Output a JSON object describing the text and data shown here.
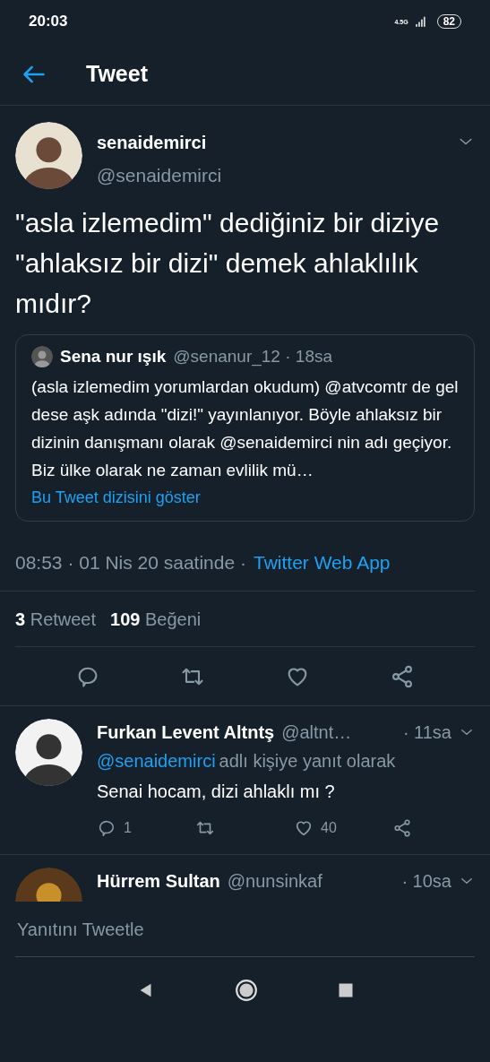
{
  "status_bar": {
    "time": "20:03",
    "network": "4.5G",
    "battery": "82"
  },
  "header": {
    "title": "Tweet"
  },
  "tweet": {
    "name": "senaidemirci",
    "handle": "@senaidemirci",
    "text": "\"asla izlemedim\" dediğiniz bir diziye \"ahlaksız bir dizi\" demek ahlaklılık mıdır?",
    "quote": {
      "name": "Sena nur ışık",
      "handle": "@senanur_12 · 18sa",
      "text": "(asla izlemedim yorumlardan okudum) @atvcomtr de gel dese aşk adında \"dizi!\" yayınlanıyor. Böyle ahlaksız bir dizinin danışmanı olarak @senaidemirci nin adı geçiyor. Biz ülke olarak ne zaman evlilik mü…",
      "link": "Bu Tweet dizisini göster"
    },
    "meta": {
      "time": "08:53 · 01 Nis 20 saatinde · ",
      "source": "Twitter Web App"
    },
    "stats": [
      {
        "count": "3",
        "label": "Retweet"
      },
      {
        "count": "109",
        "label": "Beğeni"
      }
    ]
  },
  "replies": [
    {
      "name": "Furkan Levent Altntş",
      "handle": "@altnt…",
      "time": "· 11sa",
      "reply_to": "@senaidemirci",
      "reply_suffix": "adlı kişiye yanıt olarak",
      "text": "Senai hocam, dizi ahlaklı mı ?",
      "reply_count": "1",
      "like_count": "40"
    },
    {
      "name": "Hürrem Sultan",
      "handle": "@nunsinkaf",
      "time": "· 10sa"
    }
  ],
  "composer": {
    "placeholder": "Yanıtını Tweetle"
  }
}
